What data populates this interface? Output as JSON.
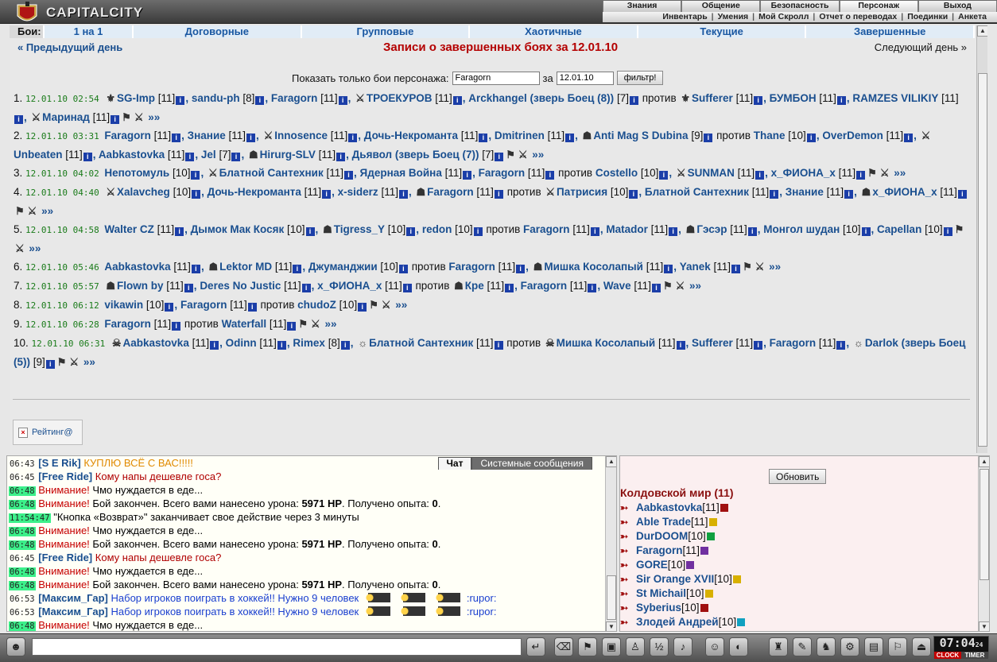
{
  "app": {
    "logo_text": "CAPITALCITY"
  },
  "topmenu": {
    "primary": [
      "Знания",
      "Общение",
      "Безопасность",
      "Персонаж",
      "Выход"
    ],
    "secondary": [
      "Инвентарь",
      "Умения",
      "Мой Скролл",
      "Отчет о переводах",
      "Поединки",
      "Анкета"
    ]
  },
  "tabs": {
    "label": "Бои:",
    "items": [
      "1 на 1",
      "Договорные",
      "Групповые",
      "Хаотичные",
      "Текущие",
      "Завершенные"
    ]
  },
  "nav": {
    "prev": "« Предыдущий день",
    "next": "Следующий день »",
    "title": "Записи о завершенных боях за 12.01.10"
  },
  "filter": {
    "label": "Показать только бои персонажа:",
    "name_value": "Faragorn",
    "date_label": "за",
    "date_value": "12.01.10",
    "button": "фильтр!"
  },
  "battles": [
    {
      "num": "1.",
      "time": "12.01.10 02:54",
      "side_a": [
        [
          "SG-Imp",
          "[11]"
        ],
        [
          "sandu-ph",
          "[8]"
        ],
        [
          "Faragorn",
          "[11]"
        ],
        [
          "ТРОЕКУРОВ",
          "[11]"
        ],
        [
          "Arckhangel (зверь Боец (8))",
          "[7]"
        ]
      ],
      "side_b": [
        [
          "Sufferer",
          "[11]"
        ],
        [
          "БУМБОН",
          "[11]"
        ],
        [
          "RAMZES VILIKIY",
          "[11]"
        ],
        [
          "Маринад",
          "[11]"
        ]
      ]
    },
    {
      "num": "2.",
      "time": "12.01.10 03:31",
      "side_a": [
        [
          "Faragorn",
          "[11]"
        ],
        [
          "Знание",
          "[11]"
        ],
        [
          "Innosence",
          "[11]"
        ],
        [
          "Дочь-Некроманта",
          "[11]"
        ],
        [
          "Dmitrinen",
          "[11]"
        ],
        [
          "Anti Mag S Dubina",
          "[9]"
        ]
      ],
      "side_b": [
        [
          "Thane",
          "[10]"
        ],
        [
          "OverDemon",
          "[11]"
        ],
        [
          "Unbeaten",
          "[11]"
        ],
        [
          "Aabkastovka",
          "[11]"
        ],
        [
          "Jel",
          "[7]"
        ],
        [
          "Hirurg-SLV",
          "[11]"
        ],
        [
          "Дьявол (зверь Боец (7))",
          "[7]"
        ]
      ]
    },
    {
      "num": "3.",
      "time": "12.01.10 04:02",
      "side_a": [
        [
          "Непотомуль",
          "[10]"
        ],
        [
          "Блатной Сантехник",
          "[11]"
        ],
        [
          "Ядерная Война",
          "[11]"
        ],
        [
          "Faragorn",
          "[11]"
        ]
      ],
      "side_b": [
        [
          "Costello",
          "[10]"
        ],
        [
          "SUNMAN",
          "[11]"
        ],
        [
          "x_ФИОНА_x",
          "[11]"
        ]
      ]
    },
    {
      "num": "4.",
      "time": "12.01.10 04:40",
      "side_a": [
        [
          "Xalavcheg",
          "[10]"
        ],
        [
          "Дочь-Некроманта",
          "[11]"
        ],
        [
          "x-siderz",
          "[11]"
        ],
        [
          "Faragorn",
          "[11]"
        ]
      ],
      "side_b": [
        [
          "Патрисия",
          "[10]"
        ],
        [
          "Блатной Сантехник",
          "[11]"
        ],
        [
          "Знание",
          "[11]"
        ],
        [
          "x_ФИОНА_x",
          "[11]"
        ]
      ]
    },
    {
      "num": "5.",
      "time": "12.01.10 04:58",
      "side_a": [
        [
          "Walter CZ",
          "[11]"
        ],
        [
          "Дымок Мак Косяк",
          "[10]"
        ],
        [
          "Tigress_Y",
          "[10]"
        ],
        [
          "redon",
          "[10]"
        ]
      ],
      "side_b": [
        [
          "Faragorn",
          "[11]"
        ],
        [
          "Matador",
          "[11]"
        ],
        [
          "Гэсэр",
          "[11]"
        ],
        [
          "Монгол шудан",
          "[10]"
        ],
        [
          "Capellan",
          "[10]"
        ]
      ]
    },
    {
      "num": "6.",
      "time": "12.01.10 05:46",
      "side_a": [
        [
          "Aabkastovka",
          "[11]"
        ],
        [
          "Lektor MD",
          "[11]"
        ],
        [
          "Джуманджии",
          "[10]"
        ]
      ],
      "side_b": [
        [
          "Faragorn",
          "[11]"
        ],
        [
          "Мишка Косолапый",
          "[11]"
        ],
        [
          "Yanek",
          "[11]"
        ]
      ]
    },
    {
      "num": "7.",
      "time": "12.01.10 05:57",
      "side_a": [
        [
          "Flown by",
          "[11]"
        ],
        [
          "Deres No Justic",
          "[11]"
        ],
        [
          "x_ФИОНА_x",
          "[11]"
        ]
      ],
      "side_b": [
        [
          "Кре",
          "[11]"
        ],
        [
          "Faragorn",
          "[11]"
        ],
        [
          "Wave",
          "[11]"
        ]
      ]
    },
    {
      "num": "8.",
      "time": "12.01.10 06:12",
      "side_a": [
        [
          "vikawin",
          "[10]"
        ],
        [
          "Faragorn",
          "[11]"
        ]
      ],
      "side_b": [
        [
          "chudoZ",
          "[10]"
        ]
      ]
    },
    {
      "num": "9.",
      "time": "12.01.10 06:28",
      "side_a": [
        [
          "Faragorn",
          "[11]"
        ]
      ],
      "side_b": [
        [
          "Waterfall",
          "[11]"
        ]
      ]
    },
    {
      "num": "10.",
      "time": "12.01.10 06:31",
      "side_a": [
        [
          "Aabkastovka",
          "[11]"
        ],
        [
          "Odinn",
          "[11]"
        ],
        [
          "Rimex",
          "[8]"
        ],
        [
          "Блатной Сантехник",
          "[11]"
        ]
      ],
      "side_b": [
        [
          "Мишка Косолапый",
          "[11]"
        ],
        [
          "Sufferer",
          "[11]"
        ],
        [
          "Faragorn",
          "[11]"
        ],
        [
          "Darlok (зверь Боец (5))",
          "[9]"
        ]
      ]
    }
  ],
  "vs_label": "против",
  "more_label": "»»",
  "chel_label": "chel",
  "rating": "Рейтинг@",
  "chat": {
    "tabs": [
      "Чат",
      "Системные сообщения"
    ],
    "lines": [
      {
        "time": "06:43",
        "hl": false,
        "name": "[S E Rik]",
        "text": "КУПЛЮ ВСЁ С ВАС!!!!!",
        "cls": "cm-orange"
      },
      {
        "time": "06:45",
        "hl": false,
        "name": "[Free Ride]",
        "text": "Кому напы дешевле госа?",
        "cls": "cm-red"
      },
      {
        "time": "06:48",
        "hl": true,
        "warn": "Внимание!",
        "text": "Чмо нуждается в еде..."
      },
      {
        "time": "06:48",
        "hl": true,
        "warn": "Внимание!",
        "text": "Бой закончен. Всего вами нанесено урона:",
        "b1": "5971 HP",
        "t2": ". Получено опыта:",
        "b2": "0",
        "t3": "."
      },
      {
        "time": "11:54:47",
        "hl": true,
        "text": "\"Кнопка «Возврат»\" заканчивает свое действие через 3 минуты"
      },
      {
        "time": "06:48",
        "hl": true,
        "warn": "Внимание!",
        "text": "Чмо нуждается в еде..."
      },
      {
        "time": "06:48",
        "hl": true,
        "warn": "Внимание!",
        "text": "Бой закончен. Всего вами нанесено урона:",
        "b1": "5971 HP",
        "t2": ". Получено опыта:",
        "b2": "0",
        "t3": "."
      },
      {
        "time": "06:45",
        "hl": false,
        "name": "[Free Ride]",
        "text": "Кому напы дешевле госа?",
        "cls": "cm-red"
      },
      {
        "time": "06:48",
        "hl": true,
        "warn": "Внимание!",
        "text": "Чмо нуждается в еде..."
      },
      {
        "time": "06:48",
        "hl": true,
        "warn": "Внимание!",
        "text": "Бой закончен. Всего вами нанесено урона:",
        "b1": "5971 HP",
        "t2": ". Получено опыта:",
        "b2": "0",
        "t3": "."
      },
      {
        "time": "06:53",
        "hl": false,
        "name": "[Максим_Гар]",
        "text": "Набор игроков поиграть в хоккей!! Нужно 9 человек",
        "cls": "cm-blue",
        "rupor": ":rupor:"
      },
      {
        "time": "06:53",
        "hl": false,
        "name": "[Максим_Гар]",
        "text": "Набор игроков поиграть в хоккей!! Нужно 9 человек",
        "cls": "cm-blue",
        "rupor": ":rupor:"
      },
      {
        "time": "06:48",
        "hl": true,
        "warn": "Внимание!",
        "text": "Чмо нуждается в еде..."
      }
    ]
  },
  "online": {
    "refresh": "Обновить",
    "room": "Колдовской мир (11)",
    "users": [
      {
        "name": "Aabkastovka",
        "lvl": "[11]",
        "badge": "#a01010"
      },
      {
        "name": "Able Trade",
        "lvl": "[11]",
        "badge": "#d8b000"
      },
      {
        "name": "DurDOOM",
        "lvl": "[10]",
        "badge": "#10a040"
      },
      {
        "name": "Faragorn",
        "lvl": "[11]",
        "badge": "#7030a0"
      },
      {
        "name": "GORE",
        "lvl": "[10]",
        "badge": "#7030a0"
      },
      {
        "name": "Sir Orange XVII",
        "lvl": "[10]",
        "badge": "#d8b000"
      },
      {
        "name": "St Michail",
        "lvl": "[10]",
        "badge": "#d8b000"
      },
      {
        "name": "Syberius",
        "lvl": "[10]",
        "badge": "#a01010"
      },
      {
        "name": "Злодей Андрей",
        "lvl": "[10]",
        "badge": "#10a0c0"
      }
    ]
  },
  "clock": {
    "time": "07:04",
    "seconds": "24",
    "label1": "CLOCK",
    "label2": "TIMER"
  }
}
